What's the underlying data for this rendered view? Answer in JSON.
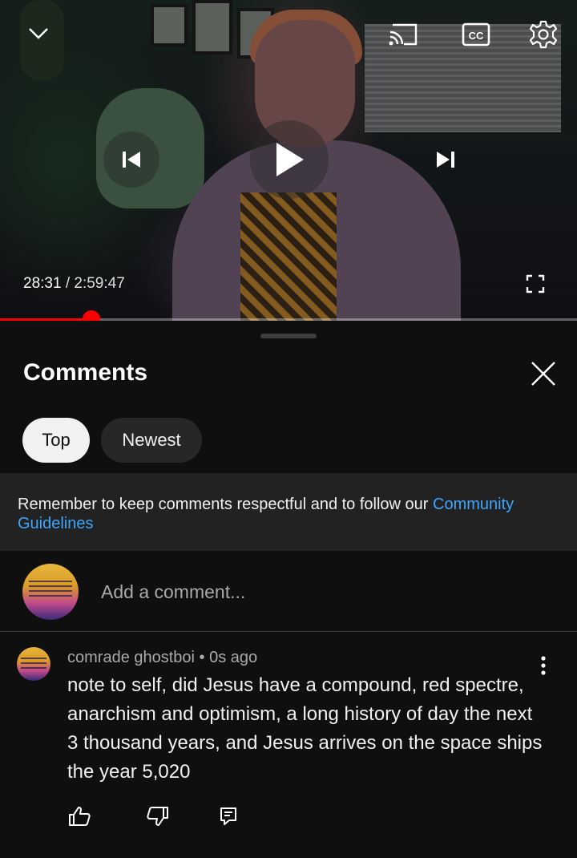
{
  "player": {
    "current_time": "28:31",
    "separator": " / ",
    "duration": "2:59:47",
    "progress_fraction": 0.159,
    "accent_color": "#ff0000",
    "icons": {
      "collapse": "chevron-down-icon",
      "cast": "cast-icon",
      "captions": "closed-captions-icon",
      "settings": "gear-icon",
      "previous": "skip-previous-icon",
      "play": "play-icon",
      "next": "skip-next-icon",
      "fullscreen": "fullscreen-icon"
    }
  },
  "comments_panel": {
    "title": "Comments",
    "filters": [
      {
        "label": "Top",
        "selected": true
      },
      {
        "label": "Newest",
        "selected": false
      }
    ],
    "notice": {
      "text": "Remember to keep comments respectful and to follow our ",
      "link": "Community Guidelines"
    },
    "add_comment_placeholder": "Add a comment...",
    "comments": [
      {
        "author": "comrade ghostboi",
        "meta_separator": " • ",
        "age": "0s ago",
        "text": "note to self, did Jesus have a compound, red spectre, anarchism and optimism, a long history of day the next 3 thousand years, and Jesus arrives on the space ships the year 5,020"
      }
    ]
  },
  "colors": {
    "background": "#0f0f0f",
    "link": "#3ea6ff",
    "chip_active_bg": "#f1f1f1",
    "chip_inactive_bg": "#272727"
  }
}
